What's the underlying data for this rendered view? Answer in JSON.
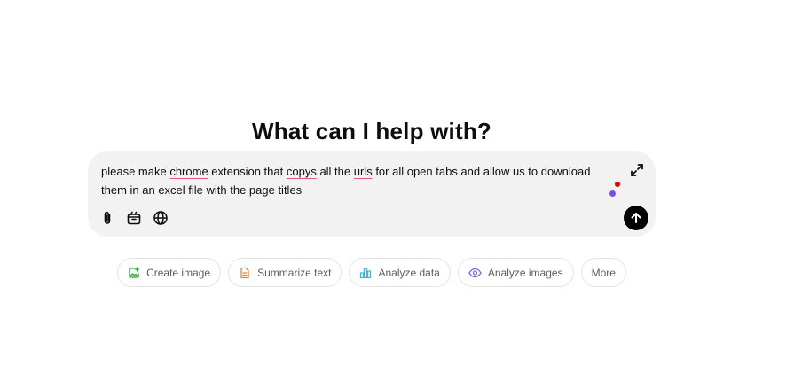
{
  "main": {
    "heading": "What can I help with?"
  },
  "composer": {
    "text_parts": [
      "please make ",
      "chrome",
      " extension that ",
      "copys",
      " all the ",
      "urls",
      " for all open tabs and allow us to download them in an excel file with the page titles"
    ],
    "icons": {
      "expand": "expand-icon",
      "attach": "paperclip-icon",
      "tools": "tools-icon",
      "web": "globe-icon",
      "send": "arrow-up-icon"
    }
  },
  "suggestions": [
    {
      "label": "Create image",
      "icon": "image-plus-icon",
      "color": "#2ea043"
    },
    {
      "label": "Summarize text",
      "icon": "document-icon",
      "color": "#e8843c"
    },
    {
      "label": "Analyze data",
      "icon": "bar-chart-icon",
      "color": "#3db6d6"
    },
    {
      "label": "Analyze images",
      "icon": "eye-icon",
      "color": "#6b6bdc"
    },
    {
      "label": "More",
      "icon": "",
      "color": ""
    }
  ]
}
